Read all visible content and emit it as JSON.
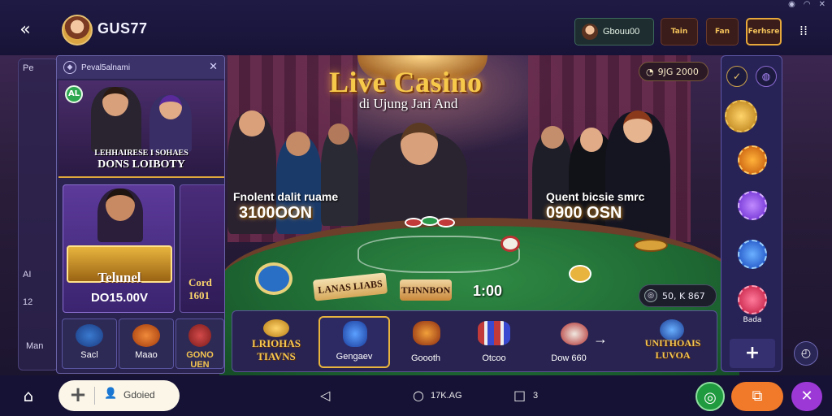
{
  "header": {
    "username": "GUS77",
    "balance_text": "Gbouu00",
    "tiles": [
      "Tain",
      "Fan",
      "Ferhsre"
    ]
  },
  "hero": {
    "title": "Live Casino",
    "subtitle": "di Ujung Jari And",
    "timer_text": "9JG 2000",
    "prize_left_label": "Fnolent dalit ruame",
    "prize_left_value": "3100OON",
    "prize_right_label": "Quent bicsie smrc",
    "prize_right_value": "0900 OSN",
    "table_sign_left": "LANAS LIABS",
    "table_sign_right": "THNNBON",
    "table_number": "1:00",
    "stat_text": "50, K 867"
  },
  "left_panel": {
    "title": "Peval5alnami",
    "feature_badge": "AL",
    "feature_caption_top": "LEHHAIRESE I SOHAES",
    "feature_caption_bottom": "DONS LOIBOTY",
    "game_label": "Telunel",
    "game_value": "DO15.00V",
    "side_card_top": "Cord",
    "side_card_bottom": "1601",
    "tiles": [
      "Sacl",
      "Maao",
      "GONO UEN"
    ]
  },
  "side_ghost": {
    "items": [
      "Pe",
      "AI",
      "12",
      "Man"
    ]
  },
  "strip": {
    "items": [
      {
        "name": "LRIOHAS TIAVNS"
      },
      {
        "name": "Gengaev"
      },
      {
        "name": "Goooth"
      },
      {
        "name": "Otcoo"
      },
      {
        "name": "Dow 660"
      },
      {
        "name": "UNITHOAIS LUVOA"
      }
    ],
    "arrow": "→"
  },
  "right_rail": {
    "label": "Bada",
    "add": "+"
  },
  "bottom_nav": {
    "pill_text": "Gdoied",
    "counter_text": "17K.AG",
    "page_text": "3"
  },
  "colors": {
    "accent_gold": "#f7c94b",
    "accent_green": "#2ea850",
    "accent_orange": "#f07a2a",
    "accent_purple": "#9c39d6",
    "bg_dark": "#161235"
  }
}
